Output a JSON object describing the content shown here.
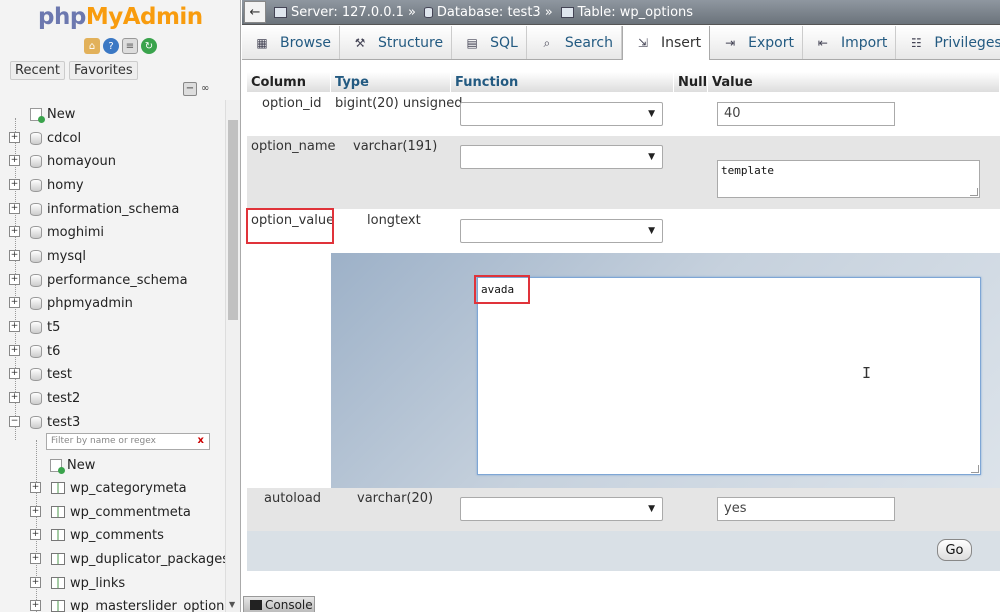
{
  "logo": {
    "php": "php",
    "myadmin": "MyAdmin"
  },
  "nav": {
    "icons": [
      "home-icon",
      "help-icon",
      "docs-icon",
      "reload-icon"
    ],
    "recent_label": "Recent",
    "favorites_label": "Favorites",
    "filter_placeholder": "Filter by name or regex",
    "filter_clear": "x",
    "new_label": "New",
    "databases": [
      "cdcol",
      "homayoun",
      "homy",
      "information_schema",
      "moghimi",
      "mysql",
      "performance_schema",
      "phpmyadmin",
      "t5",
      "t6",
      "test",
      "test2",
      "test3"
    ],
    "test3_new": "New",
    "tables": [
      "wp_categorymeta",
      "wp_commentmeta",
      "wp_comments",
      "wp_duplicator_packages",
      "wp_links",
      "wp_masterslider_options"
    ]
  },
  "breadcrumb": {
    "server": "Server: 127.0.0.1",
    "database": "Database: test3",
    "table": "Table: wp_options",
    "separator": "»"
  },
  "tabs": [
    {
      "label": "Browse",
      "icon": "browse-icon",
      "active": false
    },
    {
      "label": "Structure",
      "icon": "structure-icon",
      "active": false
    },
    {
      "label": "SQL",
      "icon": "sql-icon",
      "active": false
    },
    {
      "label": "Search",
      "icon": "search-icon",
      "active": false
    },
    {
      "label": "Insert",
      "icon": "insert-icon",
      "active": true
    },
    {
      "label": "Export",
      "icon": "export-icon",
      "active": false
    },
    {
      "label": "Import",
      "icon": "import-icon",
      "active": false
    },
    {
      "label": "Privileges",
      "icon": "privileges-icon",
      "active": false
    }
  ],
  "table": {
    "headers": {
      "column": "Column",
      "type": "Type",
      "function": "Function",
      "null": "Null",
      "value": "Value"
    },
    "rows": [
      {
        "column": "option_id",
        "type": "bigint(20) unsigned",
        "value": "40"
      },
      {
        "column": "option_name",
        "type": "varchar(191)",
        "value": "template"
      },
      {
        "column": "option_value",
        "type": "longtext",
        "value": "avada"
      },
      {
        "column": "autoload",
        "type": "varchar(20)",
        "value": "yes"
      }
    ]
  },
  "go_label": "Go",
  "console_label": "Console",
  "highlight_color": "#e0333a"
}
